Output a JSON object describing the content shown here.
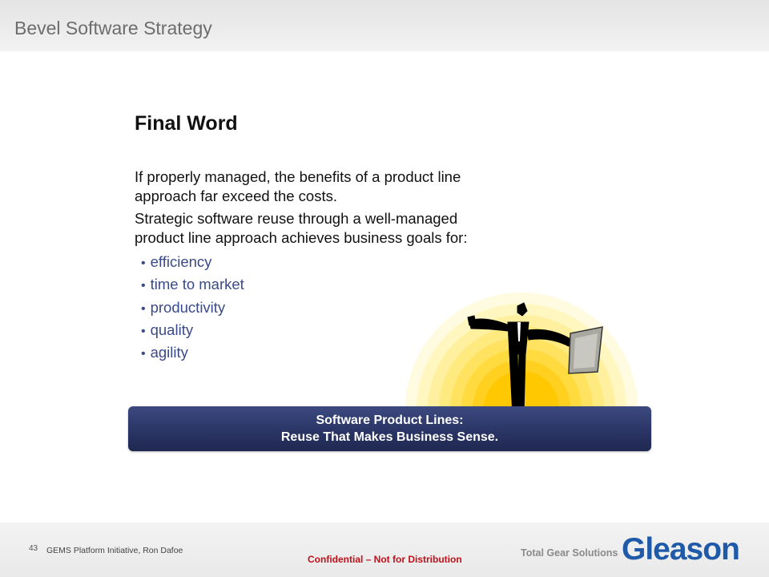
{
  "header": {
    "title": "Bevel Software Strategy"
  },
  "content": {
    "title": "Final Word",
    "paragraph1": "If properly managed, the benefits of a product line approach far exceed the costs.",
    "paragraph2": "Strategic software reuse through a well-managed product line approach achieves business goals for:",
    "bullets": [
      "efficiency",
      "time to market",
      "productivity",
      "quality",
      "agility"
    ]
  },
  "banner": {
    "line1": "Software Product Lines:",
    "line2": "Reuse That Makes Business Sense."
  },
  "illustration": {
    "icon": "businessman-sunrise-illustration"
  },
  "footer": {
    "page_number": "43",
    "author": "GEMS Platform Initiative,  Ron Dafoe",
    "confidential": "Confidential  – Not for Distribution",
    "tagline": "Total Gear Solutions",
    "logo": "Gleason"
  },
  "colors": {
    "banner": "#2b3566",
    "bullet_text": "#3a4a8a",
    "confidential": "#c0101a",
    "logo": "#1f5aa8"
  }
}
